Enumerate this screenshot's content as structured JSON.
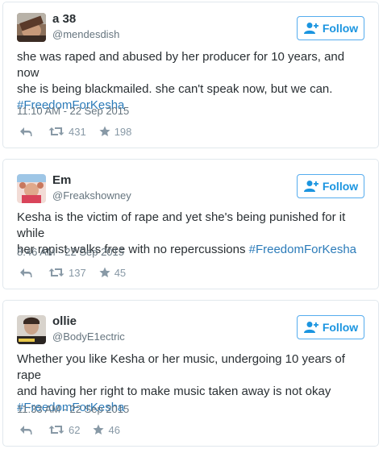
{
  "follow_label": "Follow",
  "tweets": [
    {
      "name": "a 38",
      "handle": "@mendesdish",
      "lines": [
        "she was raped and abused by her producer for 10 years, and now",
        "she is being blackmailed. she can't speak now, but we can."
      ],
      "hashtag": "#FreedomForKesha",
      "timestamp": "11:10 AM - 22 Sep 2015",
      "retweets": "431",
      "likes": "198"
    },
    {
      "name": "Em",
      "handle": "@Freakshowney",
      "lines": [
        "Kesha is the victim of rape and yet she's being punished for it while",
        "her rapist walks free with no repercussions "
      ],
      "hashtag": "#FreedomForKesha",
      "timestamp": "8:46 AM - 22 Sep 2015",
      "retweets": "137",
      "likes": "45"
    },
    {
      "name": "ollie",
      "handle": "@BodyE1ectric",
      "lines": [
        "Whether you like Kesha or her music, undergoing 10 years of rape",
        "and having her right to make music taken away is not okay"
      ],
      "hashtag": "#FreedomForKesha",
      "timestamp": "11:33 AM - 22 Sep 2015",
      "retweets": "62",
      "likes": "46"
    }
  ],
  "icons": {
    "follow": "add-user-icon",
    "reply": "reply-icon",
    "retweet": "retweet-icon",
    "like": "star-icon"
  },
  "colors": {
    "accent": "#1b95e0",
    "hashtag": "#2b7bb9",
    "muted": "#66757f",
    "action": "#8899a6",
    "border": "#e1e8ed"
  }
}
